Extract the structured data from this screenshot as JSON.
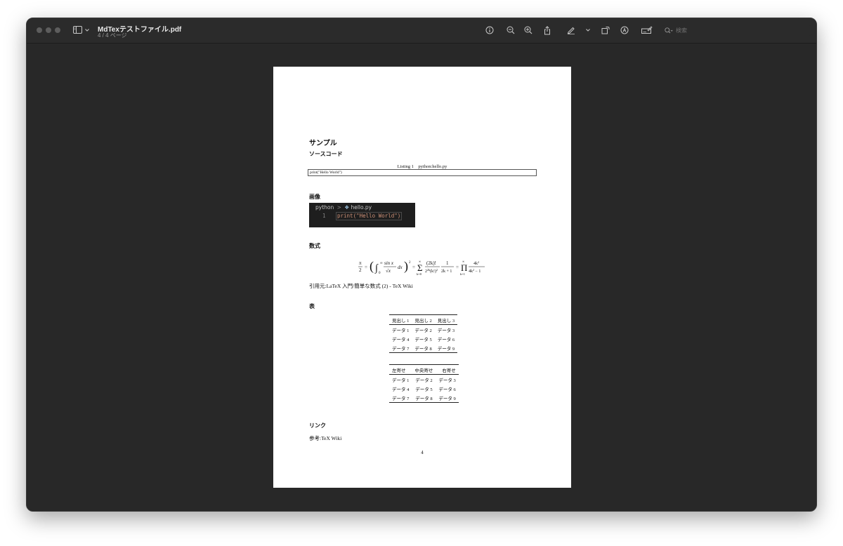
{
  "window": {
    "doc_title": "MdTexテストファイル.pdf",
    "page_info": "4 / 4 ページ",
    "search_placeholder": "検索"
  },
  "toolbar_icons": [
    "sidebar-icon",
    "chevron-down-icon",
    "info-icon",
    "zoom-out-icon",
    "zoom-in-icon",
    "share-icon",
    "markup-pen-icon",
    "chevron-down-icon",
    "rotate-icon",
    "annotate-icon",
    "form-fill-icon",
    "search-icon"
  ],
  "page": {
    "sample_heading": "サンプル",
    "source_heading": "ソースコード",
    "listing_caption": "Listing 1　python:hello.py",
    "listing_code": "print(\"Hello World\")",
    "image_heading": "画像",
    "code_image": {
      "breadcrumb_lang": "python",
      "breadcrumb_sep": ">",
      "breadcrumb_file": "hello.py",
      "line_no": "1",
      "code": "print(\"Hello World\")"
    },
    "math_heading": "数式",
    "math_citation": "引用元:LaTeX 入門/簡単な数式 (2) - TeX Wiki",
    "table_heading": "表",
    "table1": {
      "headers": [
        "見出し 1",
        "見出し 2",
        "見出し 3"
      ],
      "rows": [
        [
          "データ 1",
          "データ 2",
          "データ 3"
        ],
        [
          "データ 4",
          "データ 5",
          "データ 6"
        ],
        [
          "データ 7",
          "データ 8",
          "データ 9"
        ]
      ]
    },
    "table2": {
      "headers": [
        "左寄せ",
        "中央寄せ",
        "右寄せ"
      ],
      "rows": [
        [
          "データ 1",
          "データ 2",
          "データ 3"
        ],
        [
          "データ 4",
          "データ 5",
          "データ 6"
        ],
        [
          "データ 7",
          "データ 8",
          "データ 9"
        ]
      ]
    },
    "link_heading": "リンク",
    "link_text": "参考:TeX Wiki",
    "page_number": "4"
  },
  "colors": {
    "window_bg": "#282828",
    "titlebar_bg": "#2b2b2b",
    "page_bg": "#ffffff",
    "code_bg": "#1e1e1e",
    "code_string": "#ce9178",
    "code_func": "#dcdcaa"
  }
}
